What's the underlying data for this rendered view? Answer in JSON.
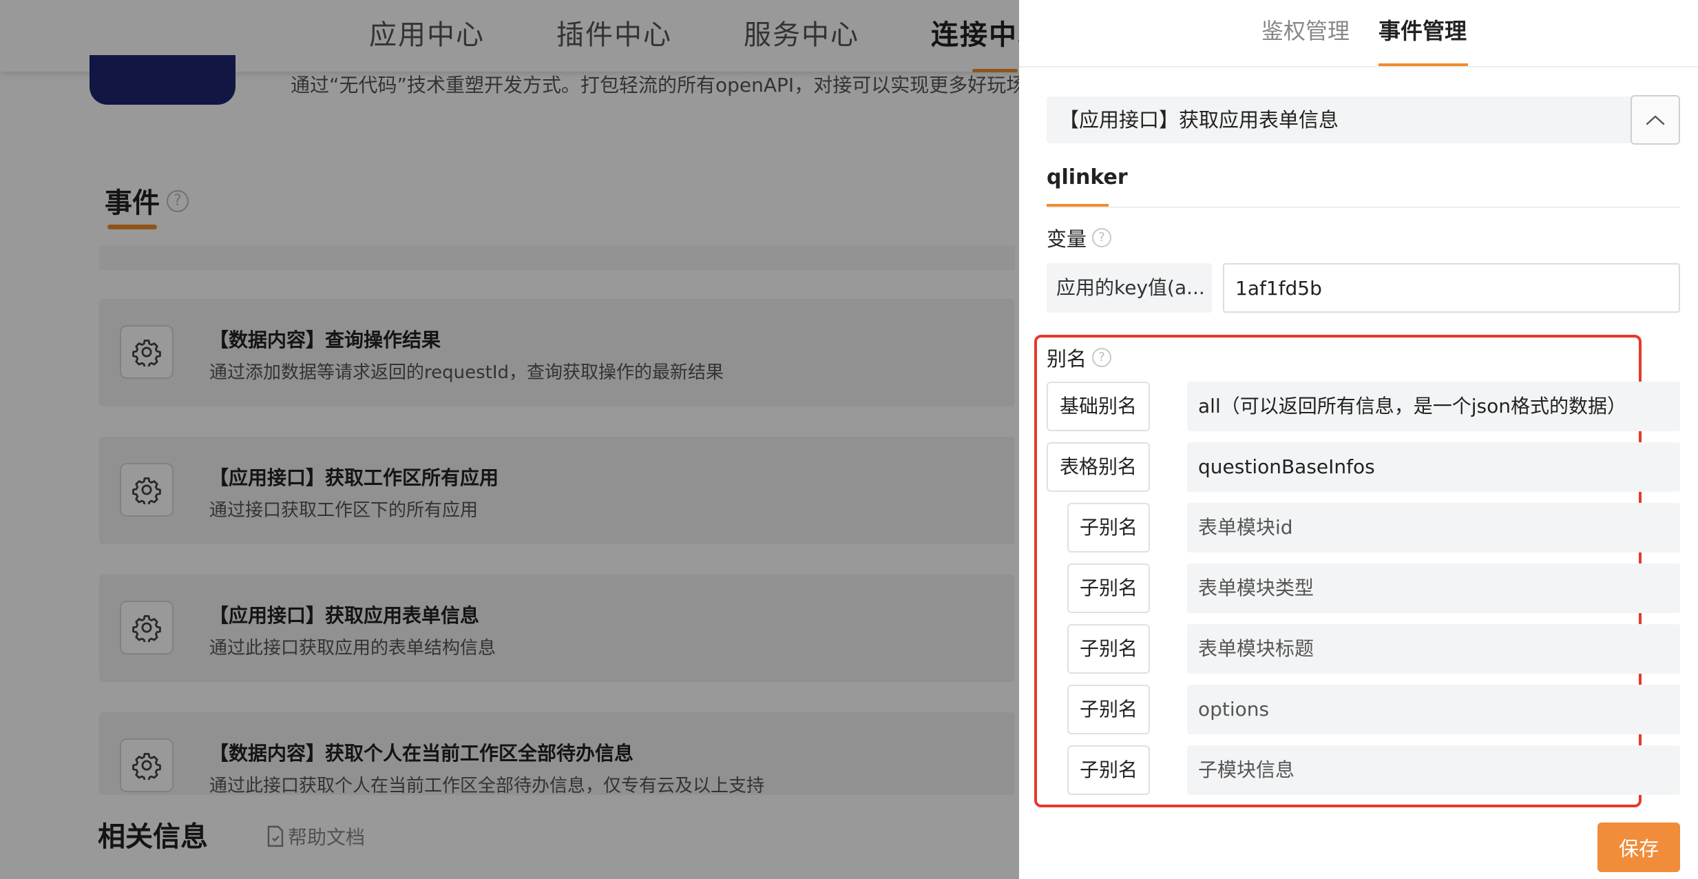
{
  "nav": {
    "items": [
      "应用中心",
      "插件中心",
      "服务中心",
      "连接中心"
    ]
  },
  "background": {
    "description": "通过“无代码”技术重塑开发方式。打包轻流的所有openAPI，对接可以实现更多好玩场",
    "events_title": "事件",
    "help_mark": "?",
    "event_cards": [
      {
        "title": "【数据内容】查询操作结果",
        "desc": "通过添加数据等请求返回的requestId，查询获取操作的最新结果"
      },
      {
        "title": "【应用接口】获取工作区所有应用",
        "desc": "通过接口获取工作区下的所有应用"
      },
      {
        "title": "【应用接口】获取应用表单信息",
        "desc": "通过此接口获取应用的表单结构信息"
      },
      {
        "title": "【数据内容】获取个人在当前工作区全部待办信息",
        "desc": "通过此接口获取个人在当前工作区全部待办信息，仅专有云及以上支持"
      }
    ],
    "related_title": "相关信息",
    "help_doc": "帮助文档"
  },
  "drawer": {
    "tabs": [
      "鉴权管理",
      "事件管理"
    ],
    "active_tab": "事件管理",
    "selected_event": "【应用接口】获取应用表单信息",
    "sub_tab": "qlinker",
    "variables_label": "变量",
    "variable_key": "应用的key值(a...",
    "variable_value": "1af1fd5b",
    "alias_label": "别名",
    "aliases": [
      {
        "tag": "基础别名",
        "value": "all（可以返回所有信息，是一个json格式的数据）"
      },
      {
        "tag": "表格别名",
        "value": "questionBaseInfos"
      },
      {
        "tag": "子别名",
        "value": "表单模块id"
      },
      {
        "tag": "子别名",
        "value": "表单模块类型"
      },
      {
        "tag": "子别名",
        "value": "表单模块标题"
      },
      {
        "tag": "子别名",
        "value": "options"
      },
      {
        "tag": "子别名",
        "value": "子模块信息"
      }
    ],
    "save_label": "保存"
  },
  "colors": {
    "accent": "#f08c2e",
    "highlight_border": "#e5392b",
    "logo": "#1d2670"
  }
}
